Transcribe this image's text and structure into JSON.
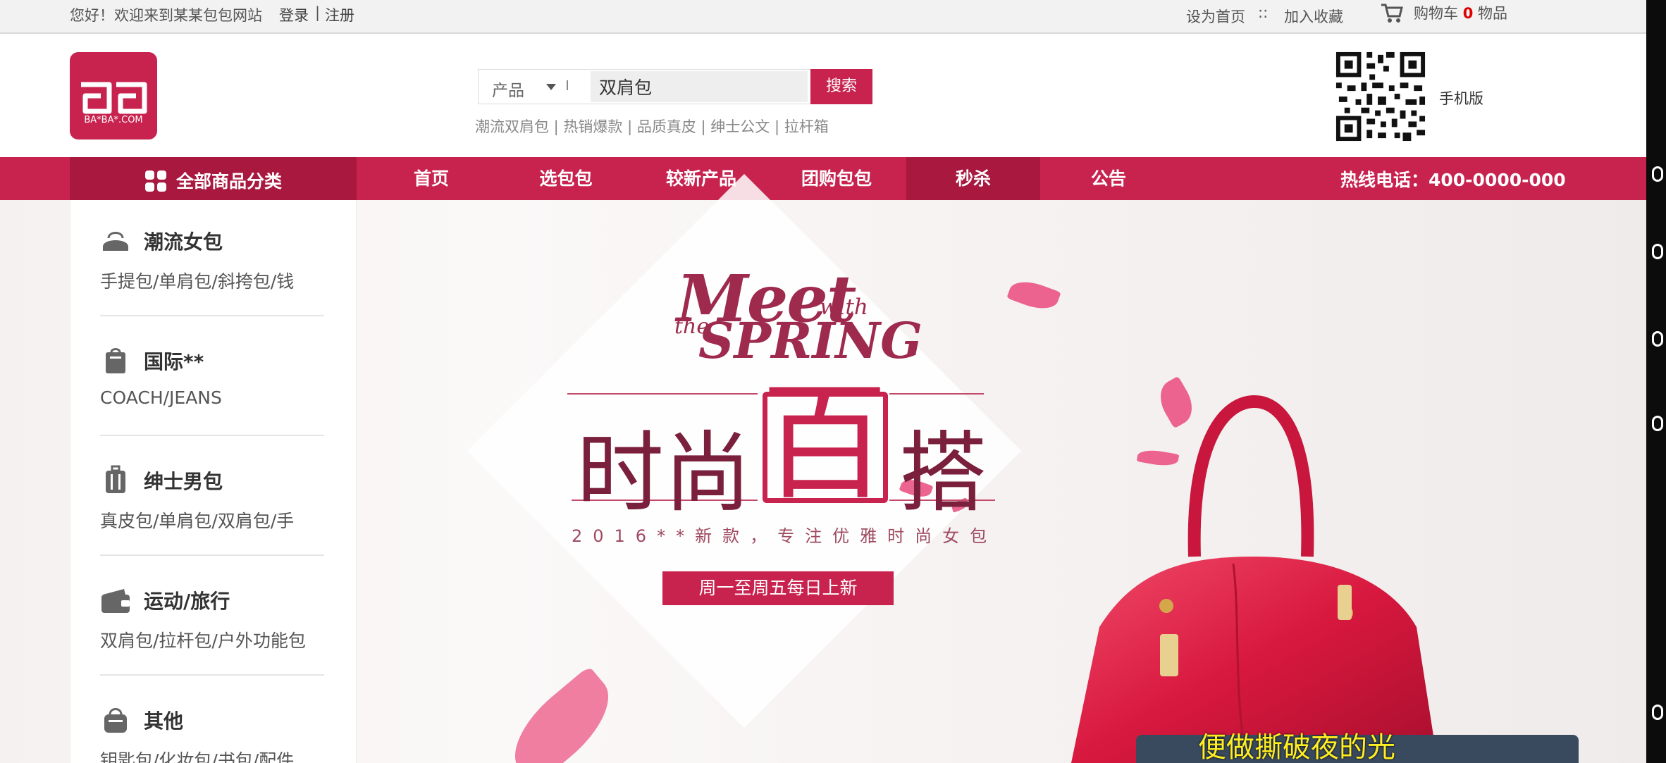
{
  "topbar": {
    "greeting": "您好！欢迎来到某某包包网站",
    "login": "登录",
    "divider": "|",
    "register": "注册",
    "set_homepage": "设为首页",
    "dots": "::",
    "add_favorite": "加入收藏",
    "cart_prefix": "购物车",
    "cart_count": "0",
    "cart_suffix": "物品"
  },
  "header": {
    "logo_text": "BA*BA*.COM",
    "search": {
      "category": "产品",
      "value": "双肩包",
      "button": "搜索"
    },
    "hot_words": "潮流双肩包 | 热销爆款 | 品质真皮 | 绅士公文 | 拉杆箱",
    "mobile_label": "手机版"
  },
  "nav": {
    "all_categories": "全部商品分类",
    "items": [
      "首页",
      "选包包",
      "较新产品",
      "团购包包",
      "秒杀",
      "公告"
    ],
    "active_item": "秒杀",
    "hotline": "热线电话：400-0000-000"
  },
  "sidebar": {
    "categories": [
      {
        "icon": "handbag-icon",
        "title": "潮流女包",
        "sub": "手提包/单肩包/斜挎包/钱"
      },
      {
        "icon": "shopping-bag-icon",
        "title": "国际**",
        "sub": "COACH/JEANS"
      },
      {
        "icon": "suitcase-icon",
        "title": "绅士男包",
        "sub": "真皮包/单肩包/双肩包/手"
      },
      {
        "icon": "wallet-icon",
        "title": "运动/旅行",
        "sub": "双肩包/拉杆包/户外功能包"
      },
      {
        "icon": "bag-icon",
        "title": "其他",
        "sub": "钥匙包/化妆包/书包/配件"
      }
    ]
  },
  "banner": {
    "meet": "Meet",
    "with": "with",
    "the": "the",
    "spring": "SPRING",
    "headline_left": "时尚",
    "headline_center": "百",
    "headline_right": "搭",
    "slogan": "2016**新款，专注优雅时尚女包",
    "cta": "周一至周五每日上新"
  },
  "overlay": {
    "caption": "便做撕破夜的光"
  },
  "colors": {
    "brand": "#c8234f",
    "brand_dark": "#a8183f",
    "cart_count": "#e00000"
  }
}
